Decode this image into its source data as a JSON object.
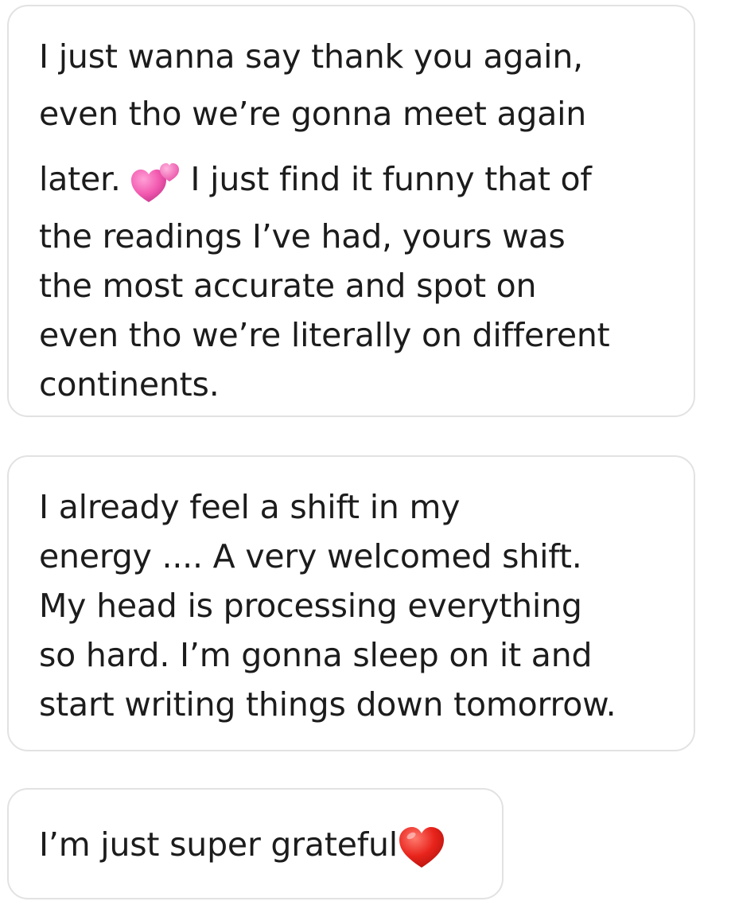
{
  "messages": [
    {
      "lines": [
        "I just wanna say thank you again,",
        "even tho we’re gonna meet again",
        {
          "before": "later. ",
          "after": " I just find it funny that of"
        },
        "the readings I’ve had, yours was",
        "the most accurate and spot on",
        "even tho we’re literally on different",
        "continents."
      ],
      "emoji": "two-hearts-icon"
    },
    {
      "lines": [
        "I already feel a shift in my",
        "energy .... A very welcomed shift.",
        "My head is processing everything",
        "so hard. I’m gonna sleep on it and",
        "start writing things down tomorrow."
      ]
    },
    {
      "text": "I’m just super grateful",
      "emoji": "red-heart-icon"
    }
  ],
  "colors": {
    "bubble_border": "#e2e2e2",
    "text": "#1c1c1c",
    "pink_heart": "#f25ab0",
    "red_heart": "#e8241c"
  }
}
